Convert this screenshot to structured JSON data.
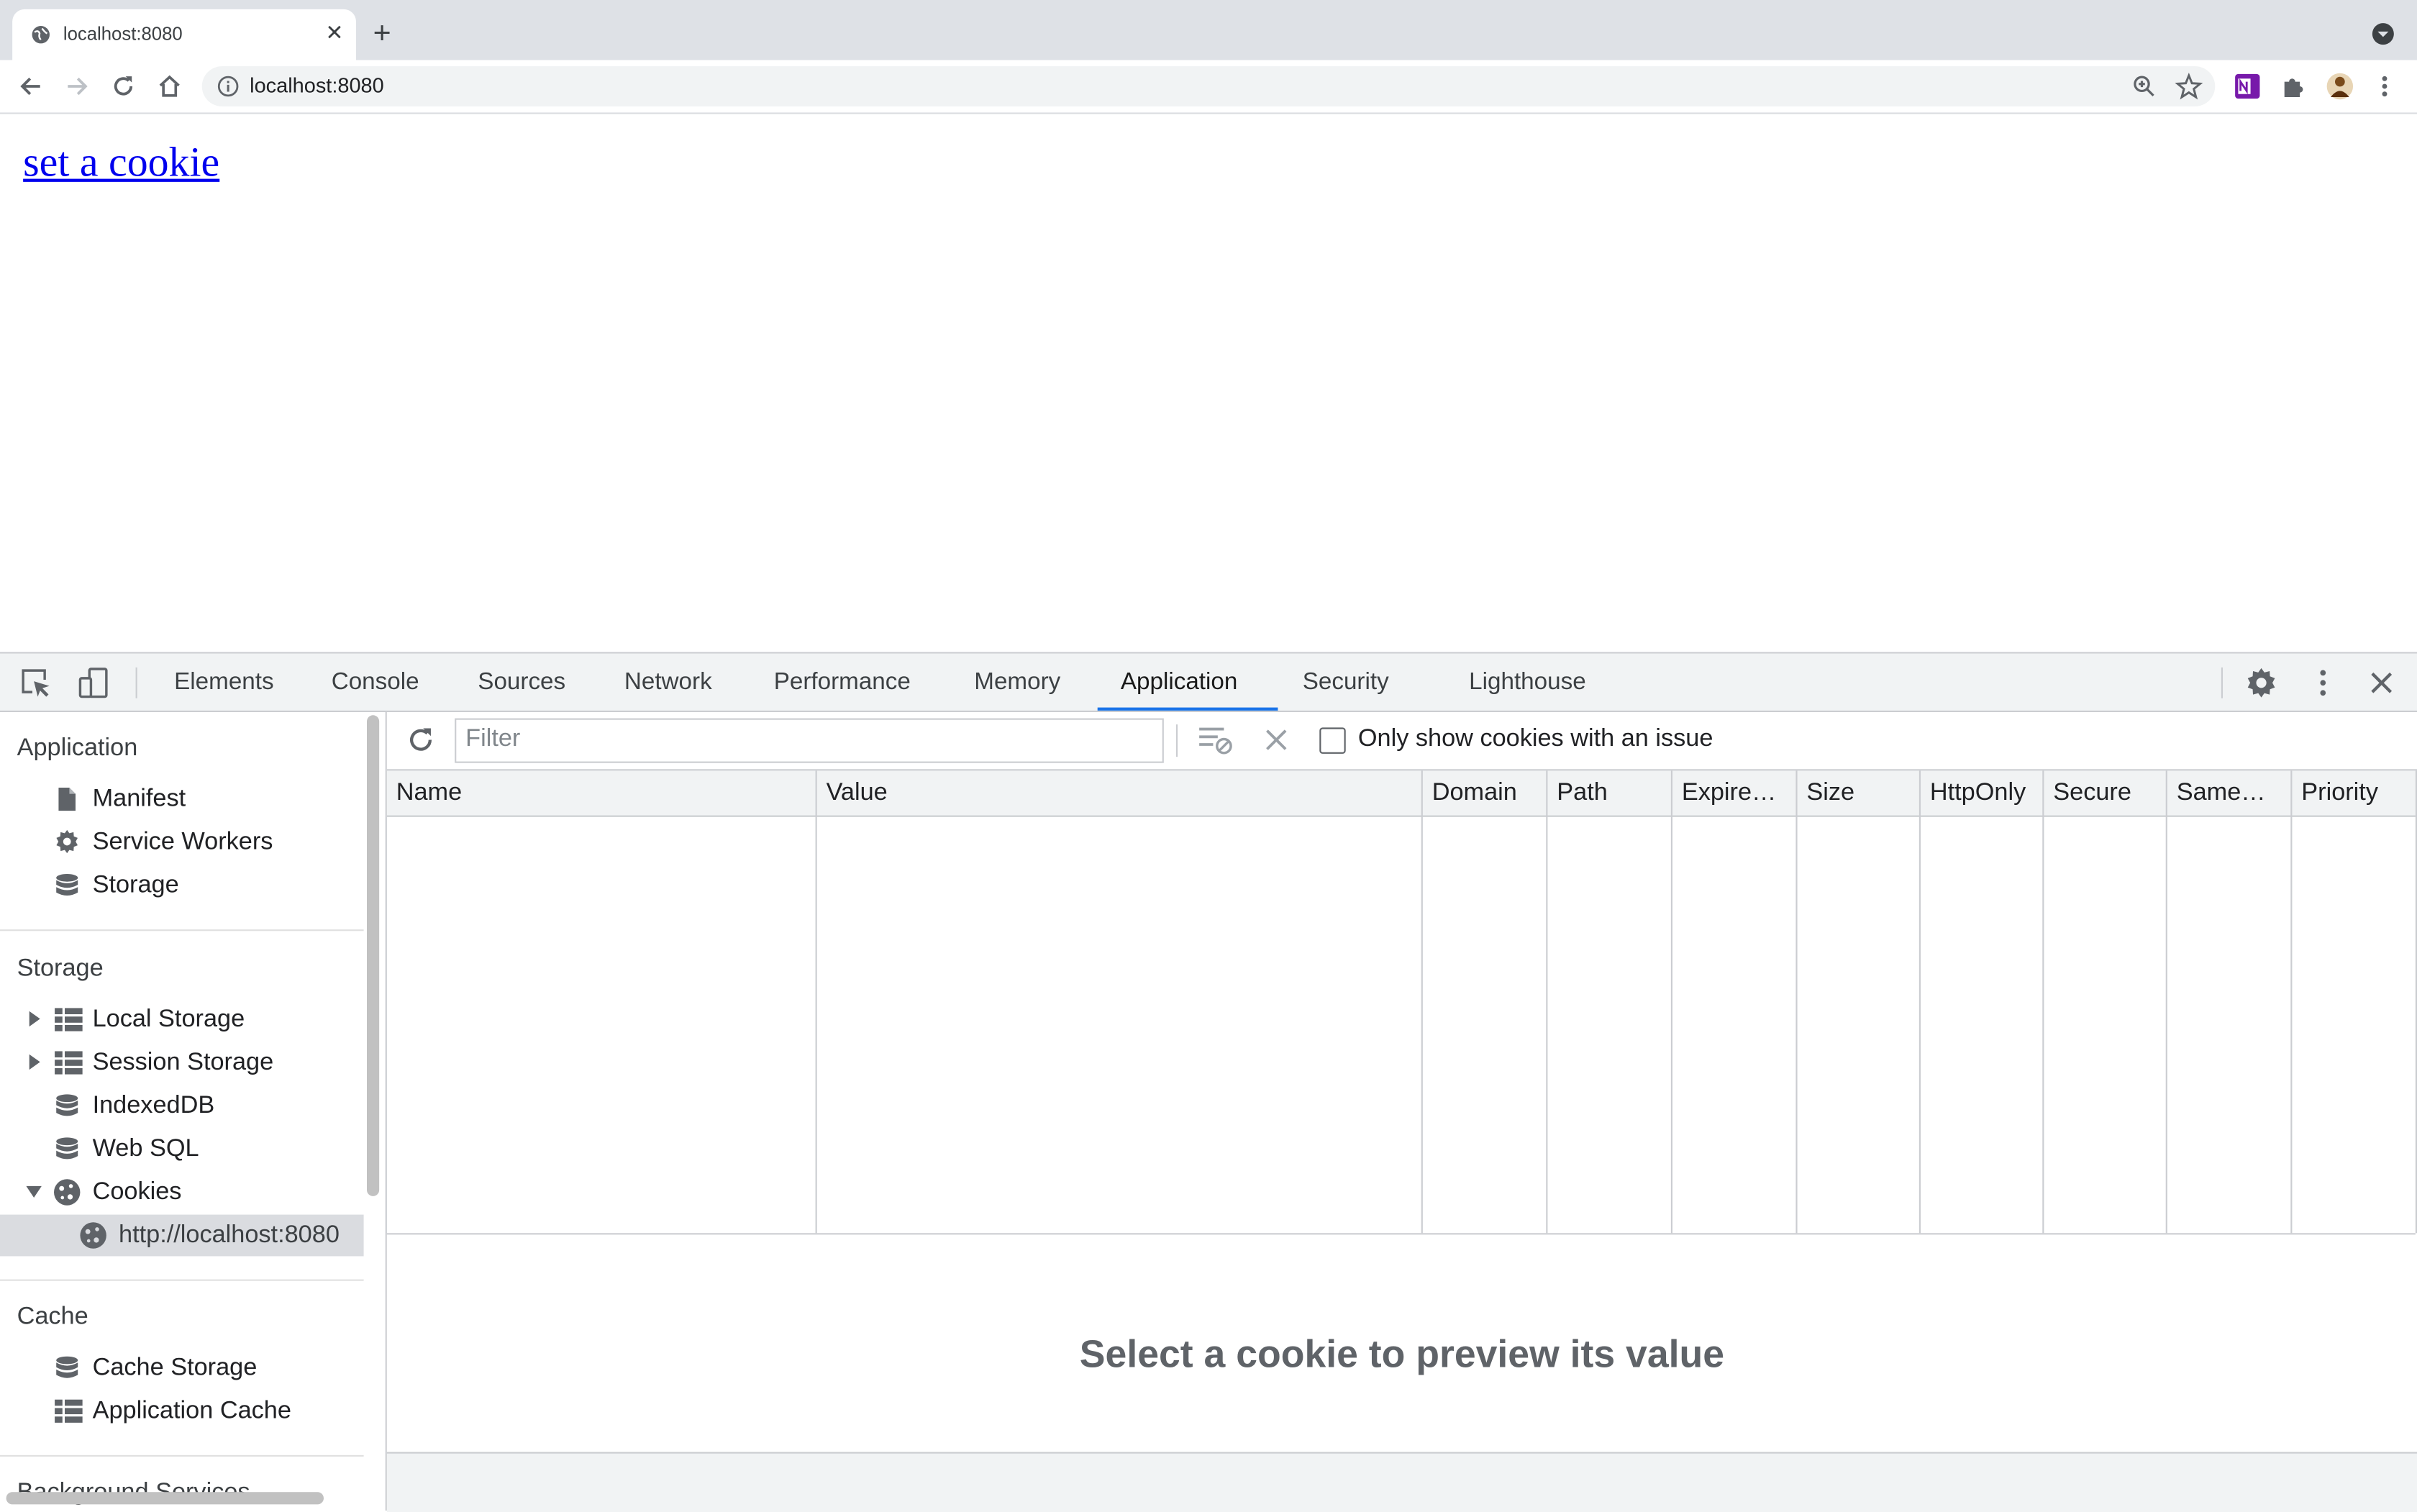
{
  "browser": {
    "tab_title": "localhost:8080",
    "url": "localhost:8080"
  },
  "page": {
    "link_text": "set a cookie"
  },
  "devtools": {
    "tabs": [
      "Elements",
      "Console",
      "Sources",
      "Network",
      "Performance",
      "Memory",
      "Application",
      "Security",
      "Lighthouse"
    ],
    "active_tab": "Application",
    "sidebar": {
      "application_header": "Application",
      "application_items": [
        "Manifest",
        "Service Workers",
        "Storage"
      ],
      "storage_header": "Storage",
      "storage_items": [
        "Local Storage",
        "Session Storage",
        "IndexedDB",
        "Web SQL",
        "Cookies"
      ],
      "cookies_child": "http://localhost:8080",
      "cache_header": "Cache",
      "cache_items": [
        "Cache Storage",
        "Application Cache"
      ],
      "next_header_partial": "Background Services"
    },
    "cookies": {
      "filter_placeholder": "Filter",
      "only_issues_label": "Only show cookies with an issue",
      "only_issues_checked": false,
      "columns": [
        "Name",
        "Value",
        "Domain",
        "Path",
        "Expire…",
        "Size",
        "HttpOnly",
        "Secure",
        "Same…",
        "Priority"
      ],
      "rows": [],
      "preview_text": "Select a cookie to preview its value"
    }
  },
  "colors": {
    "accent": "#1a73e8",
    "link": "#0000ee",
    "selected_row": "#dadce0"
  }
}
